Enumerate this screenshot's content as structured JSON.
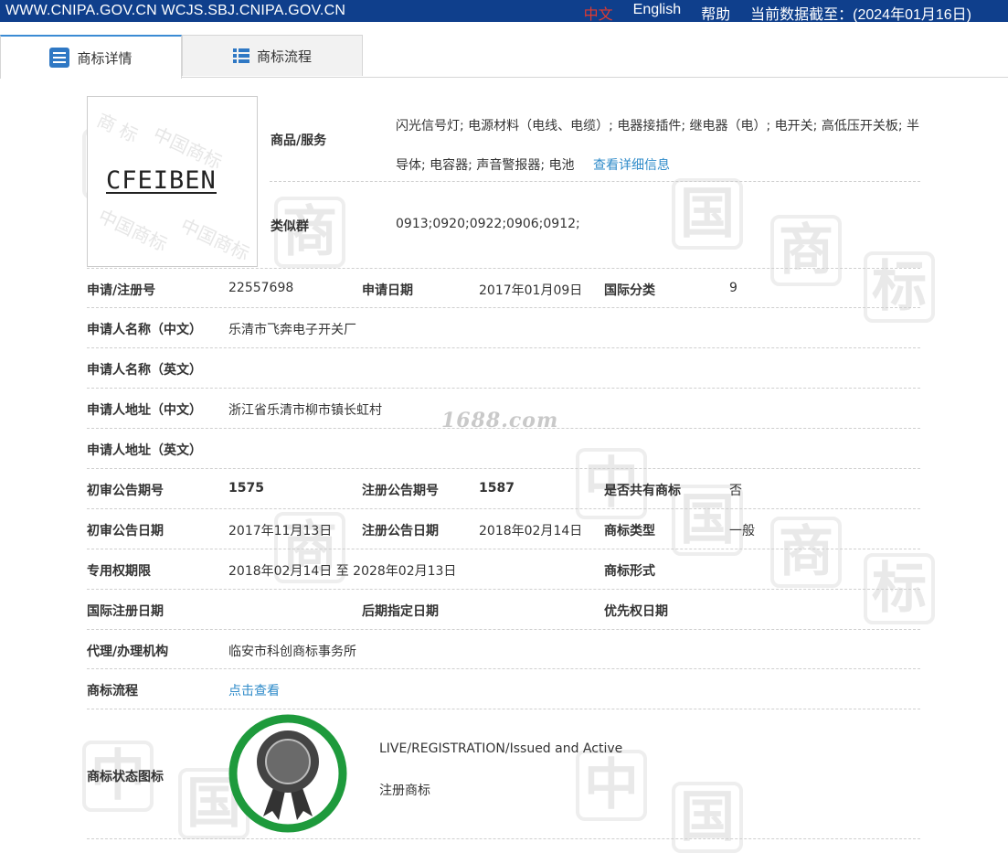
{
  "topbar": {
    "sites": "WWW.CNIPA.GOV.CN WCJS.SBJ.CNIPA.GOV.CN",
    "lang_zh": "中文",
    "lang_en": "English",
    "help": "帮助",
    "data_as_of": "当前数据截至：(2024年01月16日)"
  },
  "tabs": {
    "detail": "商标详情",
    "flow": "商标流程"
  },
  "logo": {
    "text": "CFEIBEN"
  },
  "goods": {
    "label": "商品/服务",
    "text": "闪光信号灯; 电源材料（电线、电缆）; 电器接插件; 继电器（电）; 电开关; 高低压开关板; 半导体; 电容器; 声音警报器; 电池",
    "more_link": "查看详细信息"
  },
  "similar_group": {
    "label": "类似群",
    "value": "0913;0920;0922;0906;0912;"
  },
  "fields": {
    "reg_no_label": "申请/注册号",
    "reg_no": "22557698",
    "app_date_label": "申请日期",
    "app_date": "2017年01月09日",
    "intl_class_label": "国际分类",
    "intl_class": "9",
    "applicant_cn_label": "申请人名称（中文）",
    "applicant_cn": "乐清市飞奔电子开关厂",
    "applicant_en_label": "申请人名称（英文）",
    "address_cn_label": "申请人地址（中文）",
    "address_cn": "浙江省乐清市柳市镇长虹村",
    "address_en_label": "申请人地址（英文）",
    "prelim_no_label": "初审公告期号",
    "prelim_no": "1575",
    "reg_pub_no_label": "注册公告期号",
    "reg_pub_no": "1587",
    "shared_label": "是否共有商标",
    "shared": "否",
    "prelim_date_label": "初审公告日期",
    "prelim_date": "2017年11月13日",
    "reg_pub_date_label": "注册公告日期",
    "reg_pub_date": "2018年02月14日",
    "mark_type_label": "商标类型",
    "mark_type": "一般",
    "exclusive_label": "专用权期限",
    "exclusive": "2018年02月14日 至 2028年02月13日",
    "mark_form_label": "商标形式",
    "intl_reg_date_label": "国际注册日期",
    "later_date_label": "后期指定日期",
    "priority_date_label": "优先权日期",
    "agent_label": "代理/办理机构",
    "agent": "临安市科创商标事务所",
    "flow_label": "商标流程",
    "flow_link": "点击查看",
    "status_label": "商标状态图标",
    "status_en": "LIVE/REGISTRATION/Issued and Active",
    "status_cn": "注册商标"
  },
  "watermark_site": "1688.com",
  "colors": {
    "topbar": "#0f3f8c",
    "link": "#2f8bc9",
    "seal_ring": "#1e9a3c"
  }
}
